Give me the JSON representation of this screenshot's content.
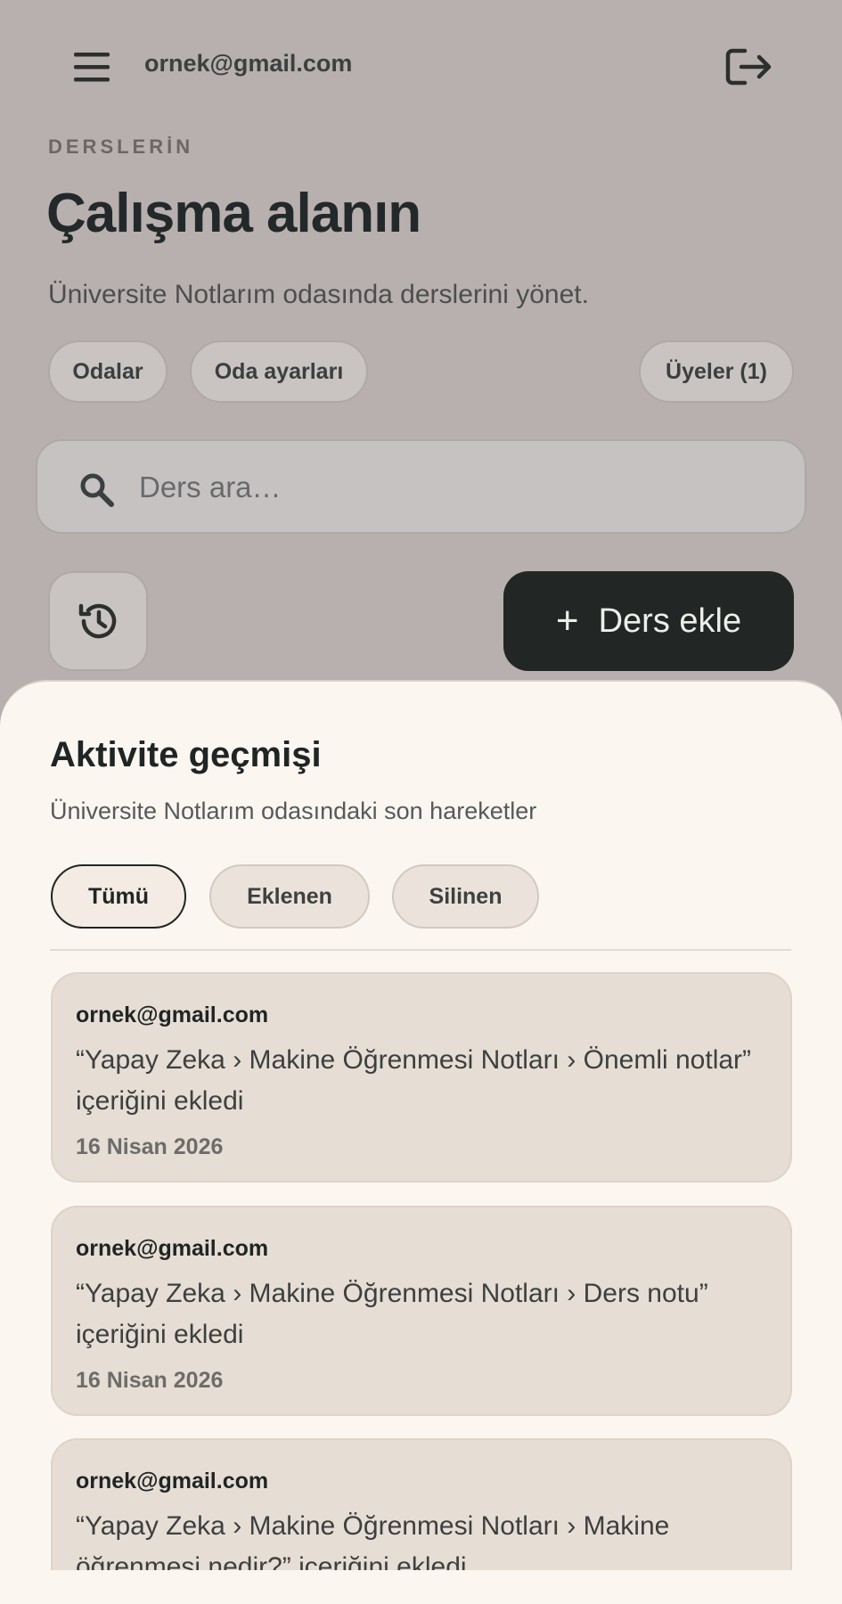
{
  "header": {
    "user_email": "ornek@gmail.com",
    "menu_icon": "hamburger-menu-icon",
    "logout_icon": "logout-icon"
  },
  "page": {
    "eyebrow": "DERSLERİN",
    "title": "Çalışma alanın",
    "subtitle": "Üniversite Notlarım odasında derslerini yönet."
  },
  "nav": {
    "rooms_label": "Odalar",
    "room_settings_label": "Oda ayarları",
    "members_label": "Üyeler (1)"
  },
  "search": {
    "placeholder": "Ders ara…",
    "value": ""
  },
  "actions": {
    "history_icon": "history-icon",
    "add_course_label": "Ders ekle"
  },
  "activity_sheet": {
    "title": "Aktivite geçmişi",
    "subtitle": "Üniversite Notlarım odasındaki son hareketler",
    "filters": [
      {
        "label": "Tümü",
        "active": true
      },
      {
        "label": "Eklenen",
        "active": false
      },
      {
        "label": "Silinen",
        "active": false
      }
    ],
    "items": [
      {
        "actor": "ornek@gmail.com",
        "action": "“Yapay Zeka › Makine Öğrenmesi Notları › Önemli notlar” içeriğini ekledi",
        "date": "16 Nisan 2026"
      },
      {
        "actor": "ornek@gmail.com",
        "action": "“Yapay Zeka › Makine Öğrenmesi Notları › Ders notu” içeriğini ekledi",
        "date": "16 Nisan 2026"
      },
      {
        "actor": "ornek@gmail.com",
        "action": "“Yapay Zeka › Makine Öğrenmesi Notları › Makine öğrenmesi nedir?” içeriğini ekledi",
        "date": ""
      }
    ]
  },
  "colors": {
    "backdrop": "#b8b0ae",
    "sheet": "#fcf6f1",
    "card": "#e6ddd4",
    "primary_button": "#222725"
  }
}
